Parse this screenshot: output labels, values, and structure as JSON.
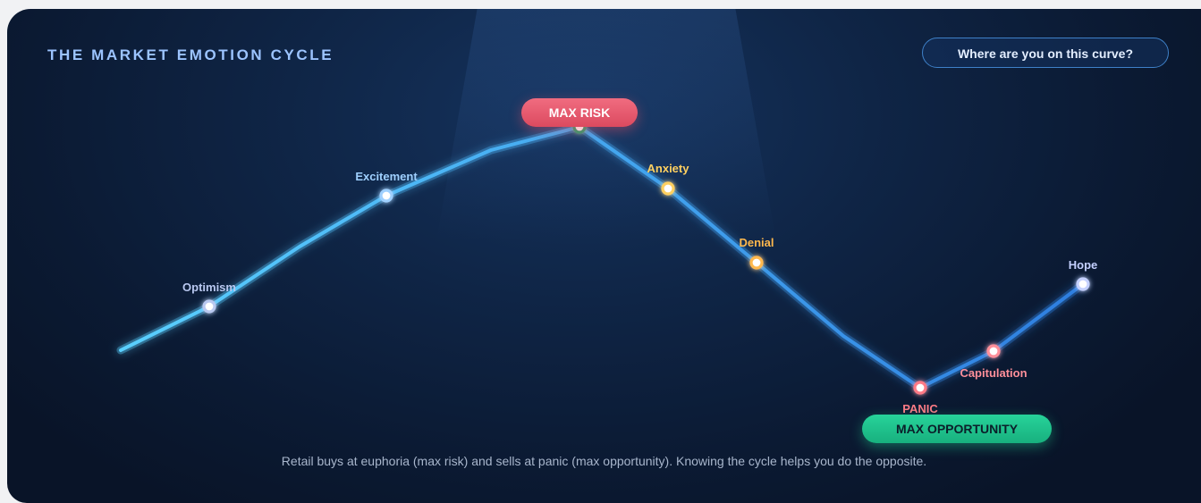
{
  "header": {
    "title": "THE MARKET EMOTION CYCLE",
    "cta_label": "Where are you on this curve?"
  },
  "badges": {
    "max_risk": "MAX RISK",
    "max_opportunity": "MAX OPPORTUNITY"
  },
  "caption": "Retail buys at euphoria (max risk) and sells at panic (max opportunity). Knowing the cycle helps you do the opposite.",
  "colors": {
    "title": "#9cc4ff",
    "line_start": "#5ad0ff",
    "line_end": "#2e7ee0",
    "optimism": "#b9c8f0",
    "excitement": "#9fd0ff",
    "euphoria": "#2f9e6e",
    "anxiety": "#ffd060",
    "denial": "#ffb84d",
    "panic": "#ff7a86",
    "capitulation": "#ff8f9a",
    "hope": "#c4d0ff",
    "risk_badge": "#e85469",
    "opportunity_badge": "#20c48c"
  },
  "chart_data": {
    "type": "line",
    "points": [
      {
        "label": "",
        "marker": false
      },
      {
        "label": "Optimism",
        "marker": true,
        "color": "optimism"
      },
      {
        "label": "",
        "marker": false
      },
      {
        "label": "Excitement",
        "marker": true,
        "color": "excitement"
      },
      {
        "label": "",
        "marker": false
      },
      {
        "label": "",
        "marker": true,
        "color": "euphoria"
      },
      {
        "label": "Anxiety",
        "marker": true,
        "color": "anxiety"
      },
      {
        "label": "Denial",
        "marker": true,
        "color": "denial"
      },
      {
        "label": "",
        "marker": false
      },
      {
        "label": "PANIC",
        "marker": true,
        "color": "panic"
      },
      {
        "label": "Capitulation",
        "marker": true,
        "color": "capitulation"
      },
      {
        "label": "Hope",
        "marker": true,
        "color": "hope"
      }
    ],
    "grid": false,
    "legend": "none"
  }
}
